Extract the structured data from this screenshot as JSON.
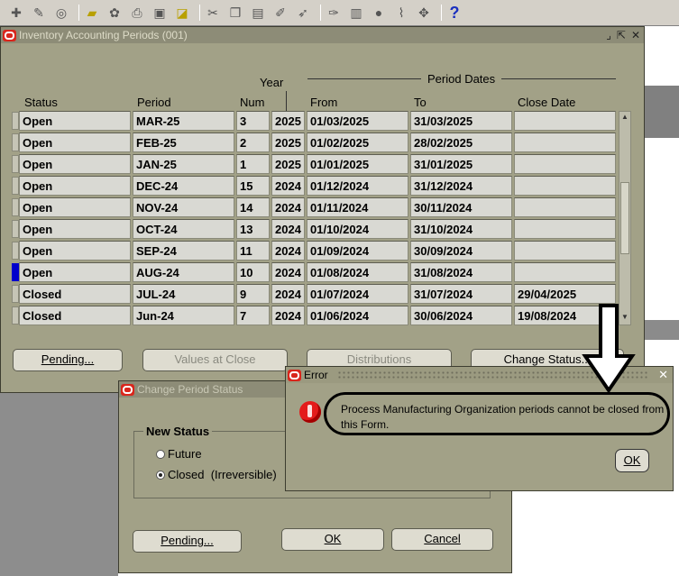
{
  "toolbar": {
    "icons": [
      "new-icon",
      "attach-icon",
      "navigator-icon",
      "folder-icon",
      "find-icon",
      "print-icon",
      "save-icon",
      "cut-icon",
      "copy-icon",
      "paste-icon",
      "clear-icon",
      "edit-icon",
      "zoom-icon",
      "translation-icon",
      "attachments-icon",
      "folder-tools-icon",
      "help-icon"
    ],
    "help_glyph": "?"
  },
  "main_window": {
    "title": "Inventory Accounting Periods (001)",
    "headers": {
      "year": "Year",
      "period_dates": "Period Dates",
      "status": "Status",
      "period": "Period",
      "num": "Num",
      "from": "From",
      "to": "To",
      "close_date": "Close Date"
    },
    "rows": [
      {
        "status": "Open",
        "period": "MAR-25",
        "num": "3",
        "year": "2025",
        "from": "01/03/2025",
        "to": "31/03/2025",
        "close": ""
      },
      {
        "status": "Open",
        "period": "FEB-25",
        "num": "2",
        "year": "2025",
        "from": "01/02/2025",
        "to": "28/02/2025",
        "close": ""
      },
      {
        "status": "Open",
        "period": "JAN-25",
        "num": "1",
        "year": "2025",
        "from": "01/01/2025",
        "to": "31/01/2025",
        "close": ""
      },
      {
        "status": "Open",
        "period": "DEC-24",
        "num": "15",
        "year": "2024",
        "from": "01/12/2024",
        "to": "31/12/2024",
        "close": ""
      },
      {
        "status": "Open",
        "period": "NOV-24",
        "num": "14",
        "year": "2024",
        "from": "01/11/2024",
        "to": "30/11/2024",
        "close": ""
      },
      {
        "status": "Open",
        "period": "OCT-24",
        "num": "13",
        "year": "2024",
        "from": "01/10/2024",
        "to": "31/10/2024",
        "close": ""
      },
      {
        "status": "Open",
        "period": "SEP-24",
        "num": "11",
        "year": "2024",
        "from": "01/09/2024",
        "to": "30/09/2024",
        "close": ""
      },
      {
        "status": "Open",
        "period": "AUG-24",
        "num": "10",
        "year": "2024",
        "from": "01/08/2024",
        "to": "31/08/2024",
        "close": ""
      },
      {
        "status": "Closed",
        "period": "JUL-24",
        "num": "9",
        "year": "2024",
        "from": "01/07/2024",
        "to": "31/07/2024",
        "close": "29/04/2025"
      },
      {
        "status": "Closed",
        "period": "Jun-24",
        "num": "7",
        "year": "2024",
        "from": "01/06/2024",
        "to": "30/06/2024",
        "close": "19/08/2024"
      }
    ],
    "current_row": 7,
    "buttons": {
      "pending": "Pending...",
      "values_at_close": "Values at Close",
      "distributions": "Distributions",
      "change_status": "Change Status..."
    }
  },
  "change_period_status": {
    "title": "Change Period Status",
    "group_label": "New Status",
    "options": [
      "Future",
      "Closed  (Irreversible)"
    ],
    "selected": "Closed  (Irreversible)",
    "buttons": {
      "pending": "Pending...",
      "ok": "OK",
      "cancel": "Cancel"
    }
  },
  "error_dialog": {
    "title": "Error",
    "message": "Process Manufacturing Organization periods cannot be closed from this Form.",
    "ok": "OK"
  }
}
